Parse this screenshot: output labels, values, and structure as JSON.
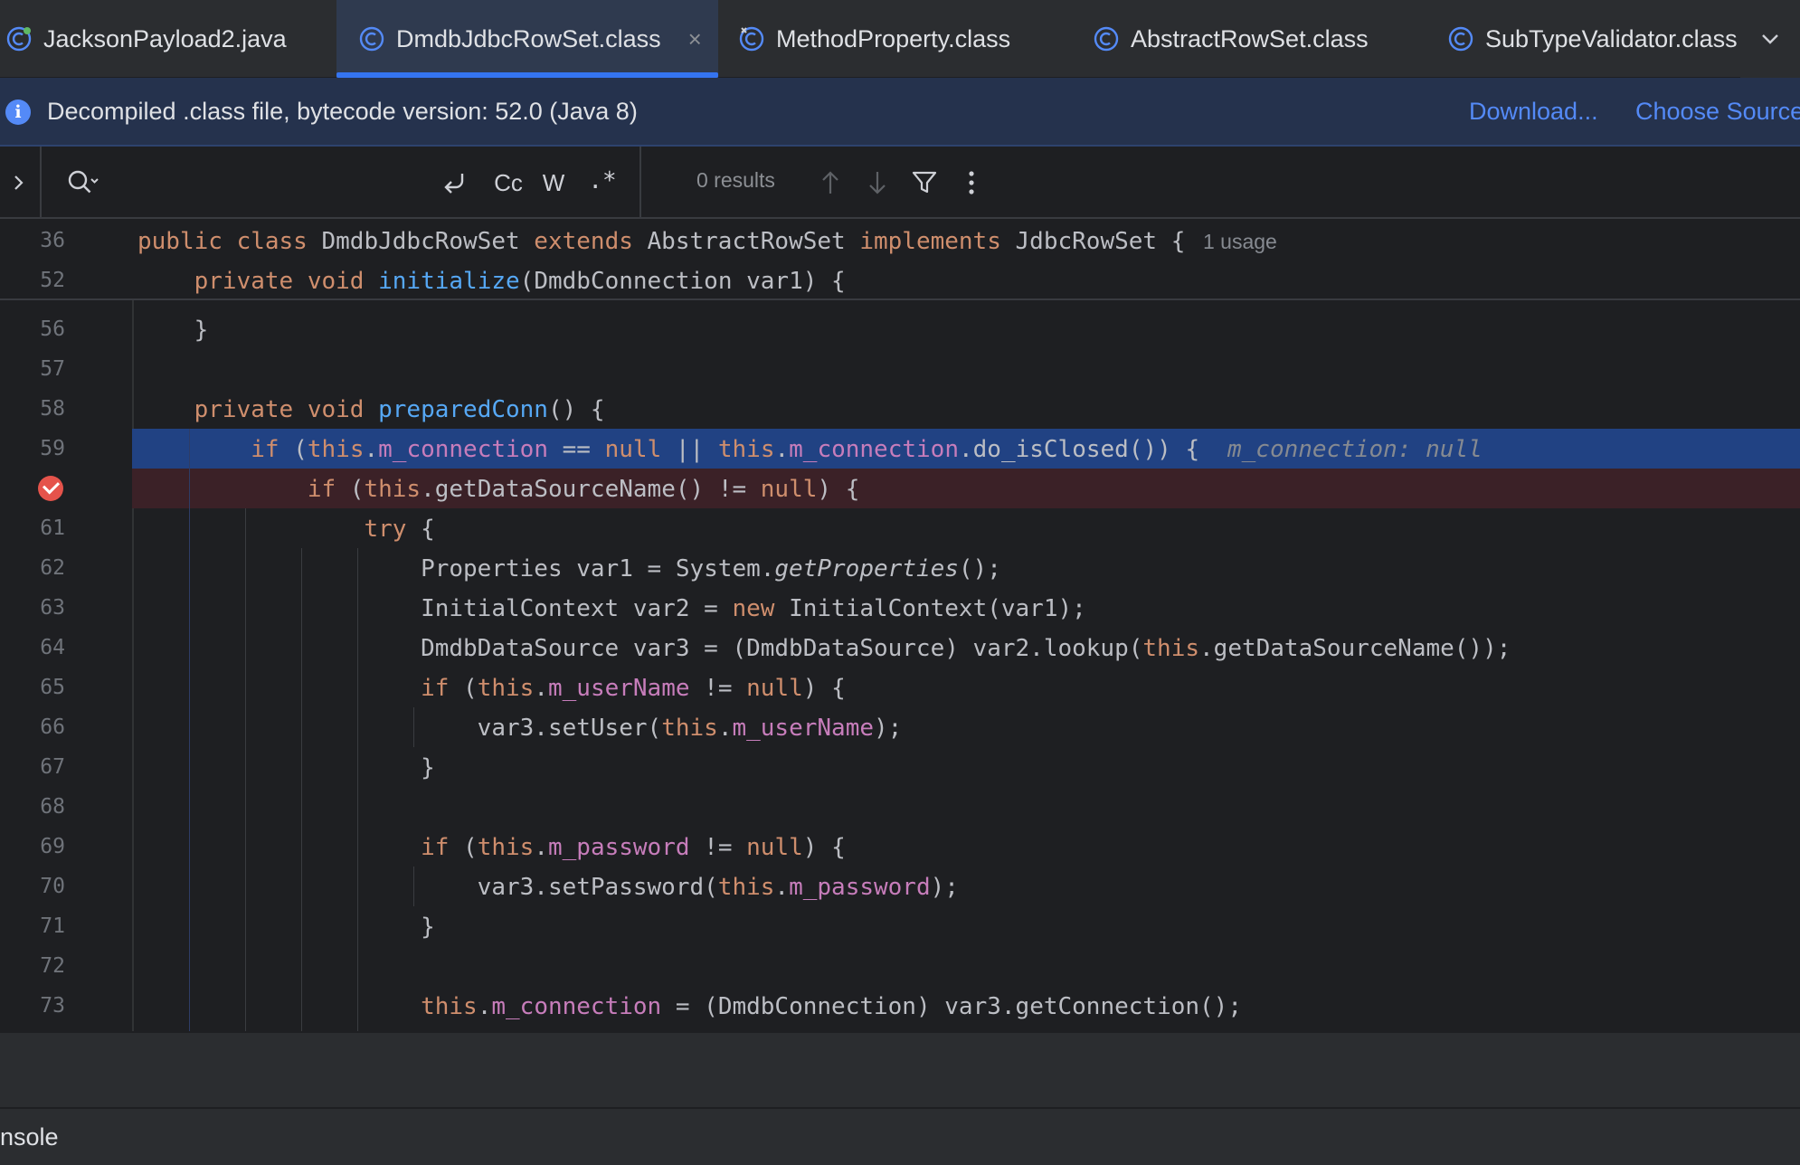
{
  "tabs": [
    {
      "label": "JacksonPayload2.java",
      "icon": "java-class-icon",
      "active": false
    },
    {
      "label": "DmdbJdbcRowSet.class",
      "icon": "class-icon",
      "active": true,
      "close": "×"
    },
    {
      "label": "MethodProperty.class",
      "icon": "class-icon",
      "active": false
    },
    {
      "label": "AbstractRowSet.class",
      "icon": "class-icon",
      "active": false
    },
    {
      "label": "SubTypeValidator.class",
      "icon": "class-icon",
      "active": false
    }
  ],
  "banner": {
    "info_glyph": "i",
    "text": "Decompiled .class file, bytecode version: 52.0 (Java 8)",
    "download_link": "Download...",
    "choose_source_link": "Choose Source"
  },
  "search": {
    "case_label": "Cc",
    "word_label": "W",
    "regex_label": ".*",
    "results": "0 results"
  },
  "editor": {
    "sticky_lines": [
      {
        "num": "36",
        "hint": "1 usage"
      },
      {
        "num": "52"
      }
    ],
    "line_numbers": [
      "56",
      "57",
      "58",
      "59",
      "",
      "61",
      "62",
      "63",
      "64",
      "65",
      "66",
      "67",
      "68",
      "69",
      "70",
      "71",
      "72",
      "73"
    ],
    "inline_value_hint": "m_connection: null",
    "breakpoint_line": "60",
    "execution_line": "59"
  },
  "bottom": {
    "console_label": "nsole"
  },
  "colors": {
    "accent": "#3574f0",
    "execution_line": "#214283",
    "breakpoint_line": "#3b2127",
    "breakpoint": "#e5534b",
    "keyword": "#cf8e6d",
    "function": "#56a8f5",
    "field": "#c77dbb"
  }
}
